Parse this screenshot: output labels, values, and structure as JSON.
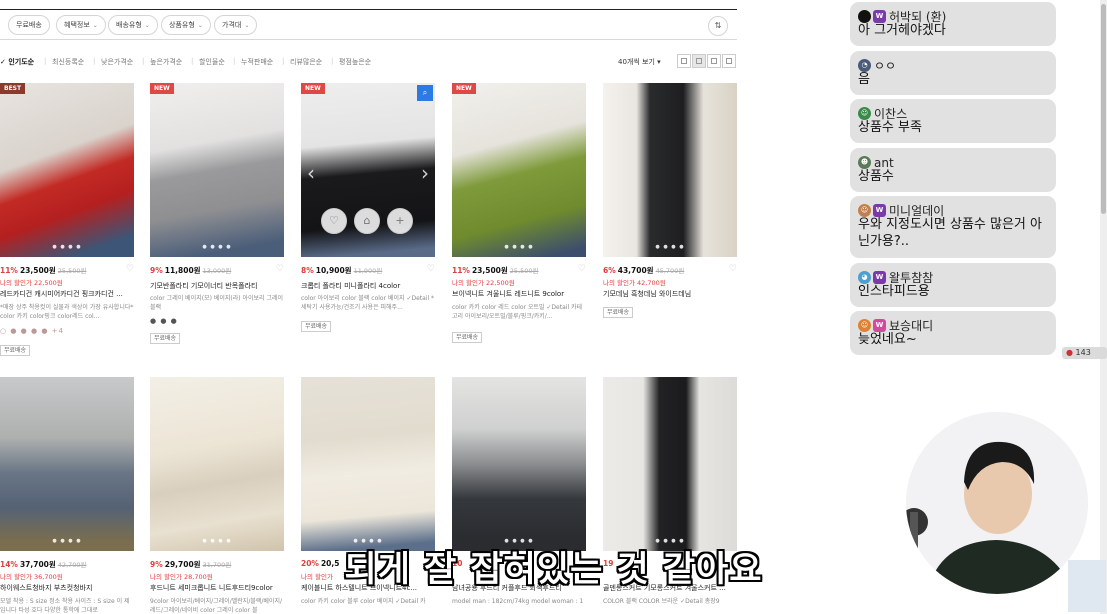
{
  "filters": [
    "무료배송",
    "혜택정보",
    "배송유형",
    "상품유형",
    "가격대"
  ],
  "filter_reset_icon": "refresh-icon",
  "sort_options": [
    "인기도순",
    "최신등록순",
    "낮은가격순",
    "높은가격순",
    "할인율순",
    "누적판매순",
    "리뷰많은순",
    "평점높은순"
  ],
  "active_sort": "인기도순",
  "view_count_label": "40개씩 보기",
  "products": [
    {
      "badge": "BEST",
      "discount": "11%",
      "price": "23,500원",
      "original": "25,500원",
      "member_price": "나의 할인가 22,500원",
      "title": "레드카디건 캐시미어카디건 핑크카디건 ...",
      "desc": "*매장 상주 착용컷이 실물과 색상이 가장 유사합니다* color 카키 color핑크 color레드 col...",
      "swatches": "○ ● ● ● ● +4",
      "shipping": "무료배송"
    },
    {
      "badge": "NEW",
      "discount": "9%",
      "price": "11,800원",
      "original": "13,000원",
      "member_price": "",
      "title": "기모반폴라티 기모이너티 반목폴라티",
      "desc": "color 그레이 베이지(모) 베이지(라) 아이보리 그레이 블랙",
      "swatches": "● ● ●",
      "shipping": "무료배송"
    },
    {
      "badge": "NEW",
      "discount": "8%",
      "price": "10,900원",
      "original": "11,900원",
      "member_price": "",
      "title": "크롭티 폴라티 미니폴라티 4color",
      "desc": "color 아이보리 color 블랙 color 베이지 ✓Detail *세탁기 사용가능/건조기 사용은 피해주...",
      "swatches": "",
      "shipping": "무료배송"
    },
    {
      "badge": "NEW",
      "discount": "11%",
      "price": "23,500원",
      "original": "25,500원",
      "member_price": "나의 할인가 22,500원",
      "title": "브이넥니트 겨울니트 레드니트 9color",
      "desc": "color 카키 color 레드 color 오트밀 ✓Detail 카테고리 아이보리/오트밀/블루/핑크/카키/...",
      "swatches": "",
      "shipping": "무료배송"
    },
    {
      "badge": "",
      "discount": "6%",
      "price": "43,700원",
      "original": "45,700원",
      "member_price": "나의 할인가 42,700원",
      "title": "기모데님 흑청데님 와이드데님",
      "desc": "",
      "swatches": "",
      "shipping": "무료배송"
    },
    {
      "badge": "",
      "discount": "14%",
      "price": "37,700원",
      "original": "42,700원",
      "member_price": "나의 할인가 36,700원",
      "title": "하이웨스트청바지 부츠컷청바지",
      "desc": "모델 착용 : S size 정소 착용 사이즈 : S size 이 제 입니다 타성 호다 다양한 통학에 그대로",
      "swatches": "",
      "shipping": ""
    },
    {
      "badge": "",
      "discount": "9%",
      "price": "29,700원",
      "original": "31,700원",
      "member_price": "나의 할인가 28,700원",
      "title": "후드니트 세미크롭니트 니트후드티9color",
      "desc": "9color 아이보리/베이지/그레이/멜란지/블랙/베이지/레드/그레이/네이비 color 그레이 color 블",
      "swatches": "",
      "shipping": ""
    },
    {
      "badge": "",
      "discount": "20%",
      "price": "20,5",
      "original": "",
      "member_price": "나의 할인가",
      "title": "케이블니트 하스텔니트 브이넥니트4c...",
      "desc": "color 카키 color 블루 color 베이지 ✓Detail 카",
      "swatches": "",
      "shipping": ""
    },
    {
      "badge": "",
      "discount": "10",
      "price": "",
      "original": "",
      "member_price": "",
      "title": "남녀공용 후드티 커플후드 회색후드티",
      "desc": "model man : 182cm/74kg model woman : 1",
      "swatches": "",
      "shipping": ""
    },
    {
      "badge": "",
      "discount": "19",
      "price": "",
      "original": "",
      "member_price": "",
      "title": "골덴롱스커트 기모롱스커트 겨울스커트 ...",
      "desc": "COLOR 블랙 COLOR 브라운 ✓Detail 총장9",
      "swatches": "",
      "shipping": ""
    }
  ],
  "chat": [
    {
      "name": "허박되 (환)",
      "message": "아 그거헤야겠다",
      "avatar_color": "#111111",
      "tier": "W"
    },
    {
      "name": "ㅇㅇ",
      "message": "음",
      "avatar_color": "#4a5a7a",
      "tier": ""
    },
    {
      "name": "이찬스",
      "message": "상품수 부족",
      "avatar_color": "#3a8a4a",
      "tier": ""
    },
    {
      "name": "ant",
      "message": "상품수",
      "avatar_color": "#5a7a5a",
      "tier": ""
    },
    {
      "name": "미니얼데이",
      "message": "우와 지정도시면 상품수 많은거 아닌가용?..",
      "avatar_color": "#c08050",
      "tier": "W"
    },
    {
      "name": "왈투참참",
      "message": "인스타피드용",
      "avatar_color": "#4aa0d0",
      "tier": "W"
    },
    {
      "name": "뵤승대디",
      "message": "늦었네요~",
      "avatar_color": "#e08030",
      "tier": "W"
    }
  ],
  "viewer_count": "143",
  "subtitle": "되게 잘 잡혀있는 것 같아요"
}
